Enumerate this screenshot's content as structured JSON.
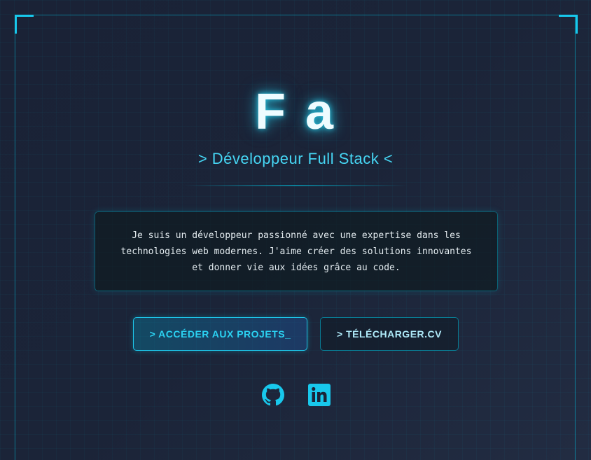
{
  "hero": {
    "name": "F a",
    "subtitle": "> Développeur Full Stack <"
  },
  "bio": {
    "text": "Je suis un développeur passionné avec une expertise dans les technologies web modernes. J'aime créer des solutions innovantes et donner vie aux idées grâce au code."
  },
  "actions": {
    "projects_label": "> ACCÉDER AUX PROJETS_",
    "cv_label": "> TÉLÉCHARGER.CV"
  },
  "social": {
    "icons": [
      "github-icon",
      "linkedin-icon"
    ]
  },
  "colors": {
    "accent": "#18c8ec",
    "background": "#1b2438",
    "text": "#eefcff"
  }
}
